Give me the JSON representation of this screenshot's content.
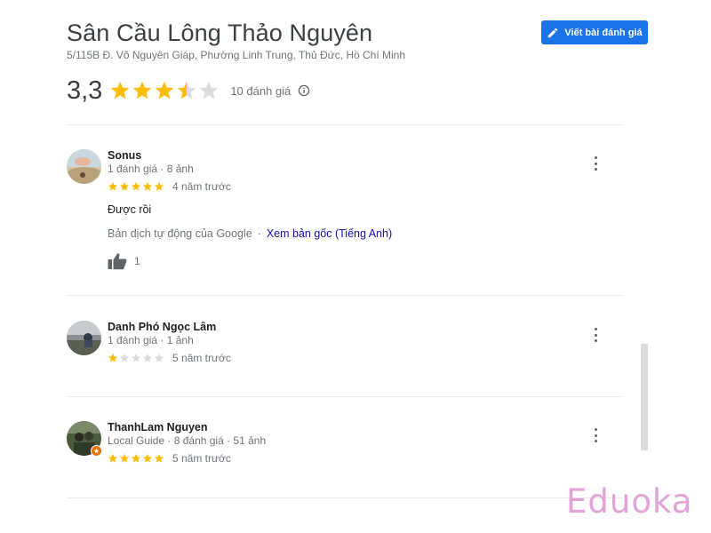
{
  "place": {
    "title": "Sân Cầu Lông Thảo Nguyên",
    "address": "5/115B Đ. Võ Nguyên Giáp, Phường Linh Trung, Thủ Đức, Hồ Chí Minh",
    "write_review_label": "Viết bài đánh giá",
    "rating_text": "3,3",
    "rating_value": 3.3,
    "review_count_label": "10 đánh giá",
    "star_color": "#fbbc04",
    "star_empty_color": "#dadce0",
    "accent_color": "#1a73e8"
  },
  "reviews": [
    {
      "name": "Sonus",
      "meta": "1 đánh giá · 8 ảnh",
      "stars": 5,
      "time": "4 năm trước",
      "text": "Được rồi",
      "translation_note": "Bản dịch tự động của Google",
      "separator": "·",
      "view_original_label": "Xem bản gốc (Tiếng Anh)",
      "like_count": "1",
      "like_icon": "thumbs-up-icon",
      "more_icon": "more-vert-icon"
    },
    {
      "name": "Danh Phó Ngọc Lâm",
      "meta": "1 đánh giá · 1 ảnh",
      "stars": 1,
      "time": "5 năm trước",
      "more_icon": "more-vert-icon"
    },
    {
      "name": "ThanhLam Nguyen",
      "meta": "Local Guide · 8 đánh giá · 51 ảnh",
      "stars": 5,
      "time": "5 năm trước",
      "badge_icon": "local-guide-badge-icon",
      "more_icon": "more-vert-icon"
    }
  ],
  "watermark": "Eduoka"
}
